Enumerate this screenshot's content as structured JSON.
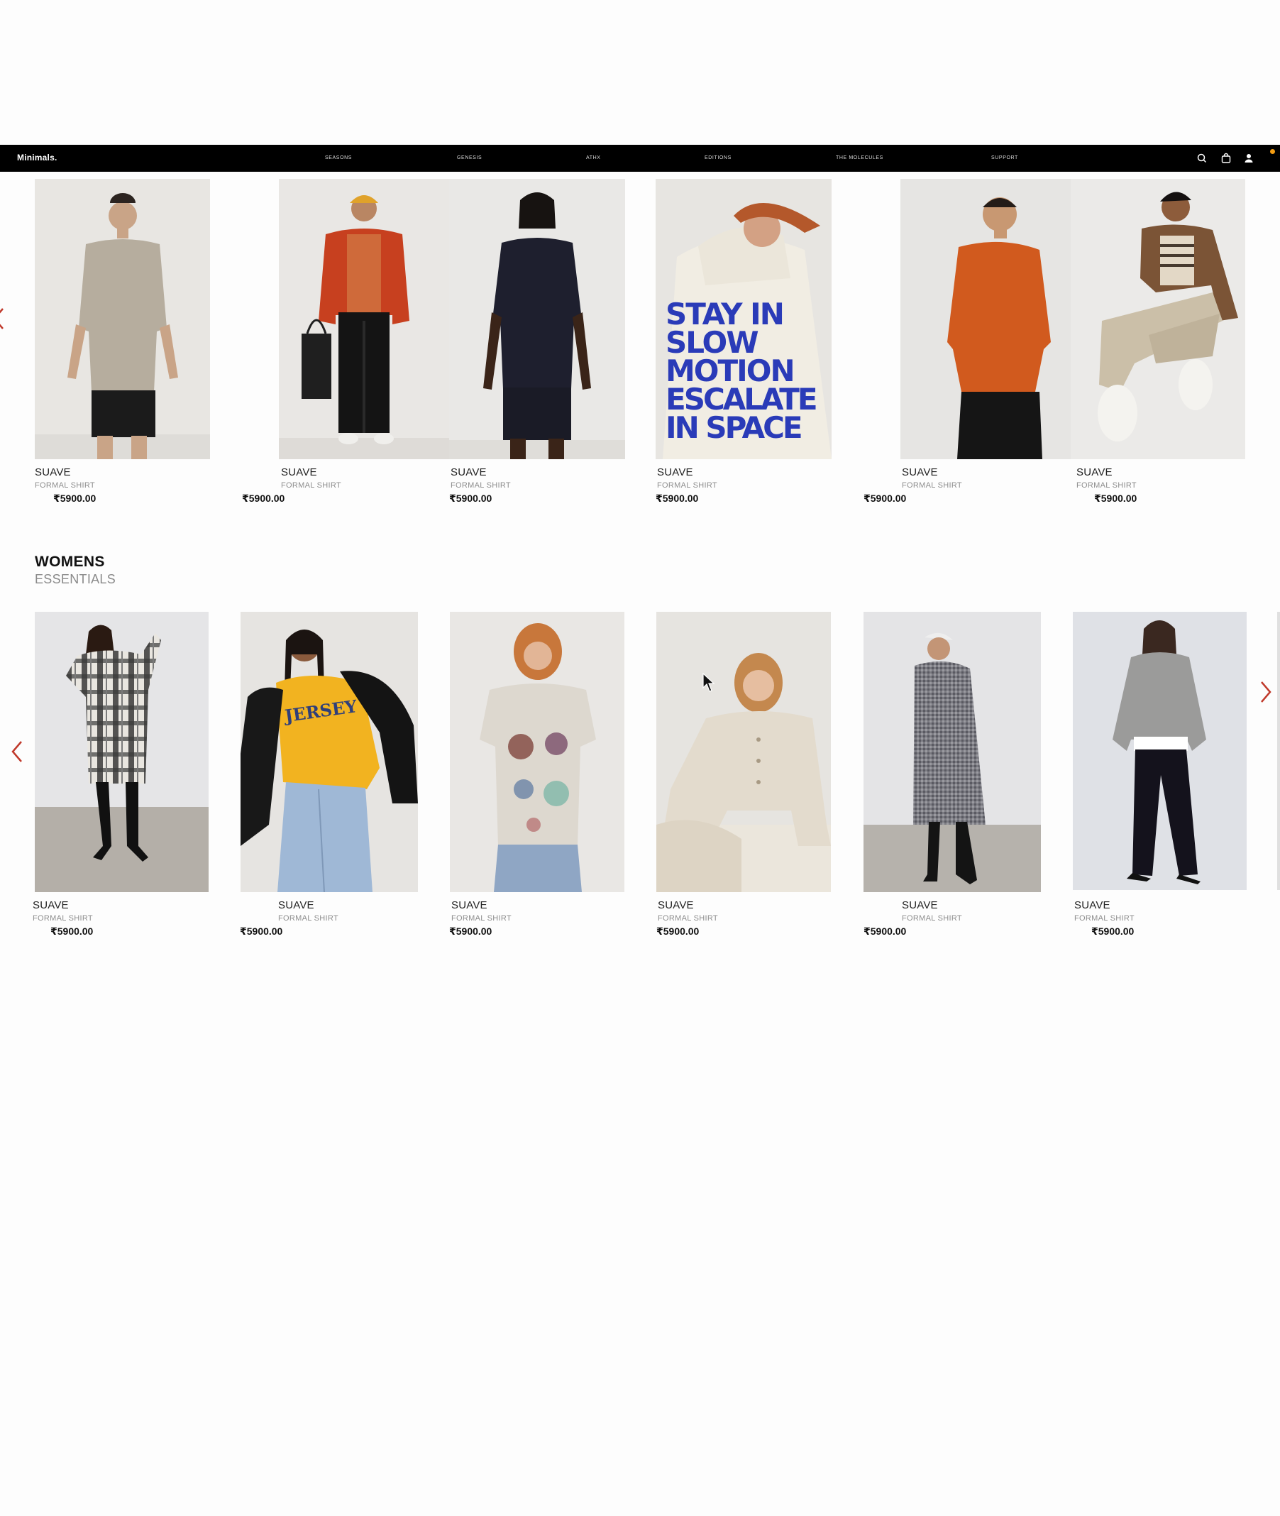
{
  "brand": "Minimals.",
  "nav": {
    "links": [
      "SEASONS",
      "GENESIS",
      "ATHX",
      "EDITIONS",
      "THE MOLECULES",
      "SUPPORT"
    ],
    "icons": [
      "search-icon",
      "bag-icon",
      "user-icon"
    ],
    "badge_color": "#f39c12"
  },
  "mens_row": {
    "products": [
      {
        "name": "SUAVE",
        "subtitle": "FORMAL SHIRT",
        "price": "₹5900.00"
      },
      {
        "name": "SUAVE",
        "subtitle": "FORMAL SHIRT",
        "price": "₹5900.00"
      },
      {
        "name": "SUAVE",
        "subtitle": "FORMAL SHIRT",
        "price": "₹5900.00"
      },
      {
        "name": "SUAVE",
        "subtitle": "FORMAL SHIRT",
        "price": "₹5900.00"
      },
      {
        "name": "SUAVE",
        "subtitle": "FORMAL SHIRT",
        "price": "₹5900.00"
      },
      {
        "name": "SUAVE",
        "subtitle": "FORMAL SHIRT",
        "price": "₹5900.00"
      }
    ],
    "hoodie_print": [
      "STAY IN",
      "SLOW",
      "MOTION",
      "ESCALATE",
      "IN SPACE"
    ]
  },
  "womens": {
    "title": "WOMENS",
    "subtitle": "ESSENTIALS",
    "products": [
      {
        "name": "SUAVE",
        "subtitle": "FORMAL SHIRT",
        "price": "₹5900.00"
      },
      {
        "name": "SUAVE",
        "subtitle": "FORMAL SHIRT",
        "price": "₹5900.00"
      },
      {
        "name": "SUAVE",
        "subtitle": "FORMAL SHIRT",
        "price": "₹5900.00"
      },
      {
        "name": "SUAVE",
        "subtitle": "FORMAL SHIRT",
        "price": "₹5900.00"
      },
      {
        "name": "SUAVE",
        "subtitle": "FORMAL SHIRT",
        "price": "₹5900.00"
      },
      {
        "name": "SUAVE",
        "subtitle": "FORMAL SHIRT",
        "price": "₹5900.00"
      }
    ],
    "sweater_print": "JERSEY"
  },
  "colors": {
    "accent_arrow": "#c0392b",
    "navbar": "#000000"
  }
}
